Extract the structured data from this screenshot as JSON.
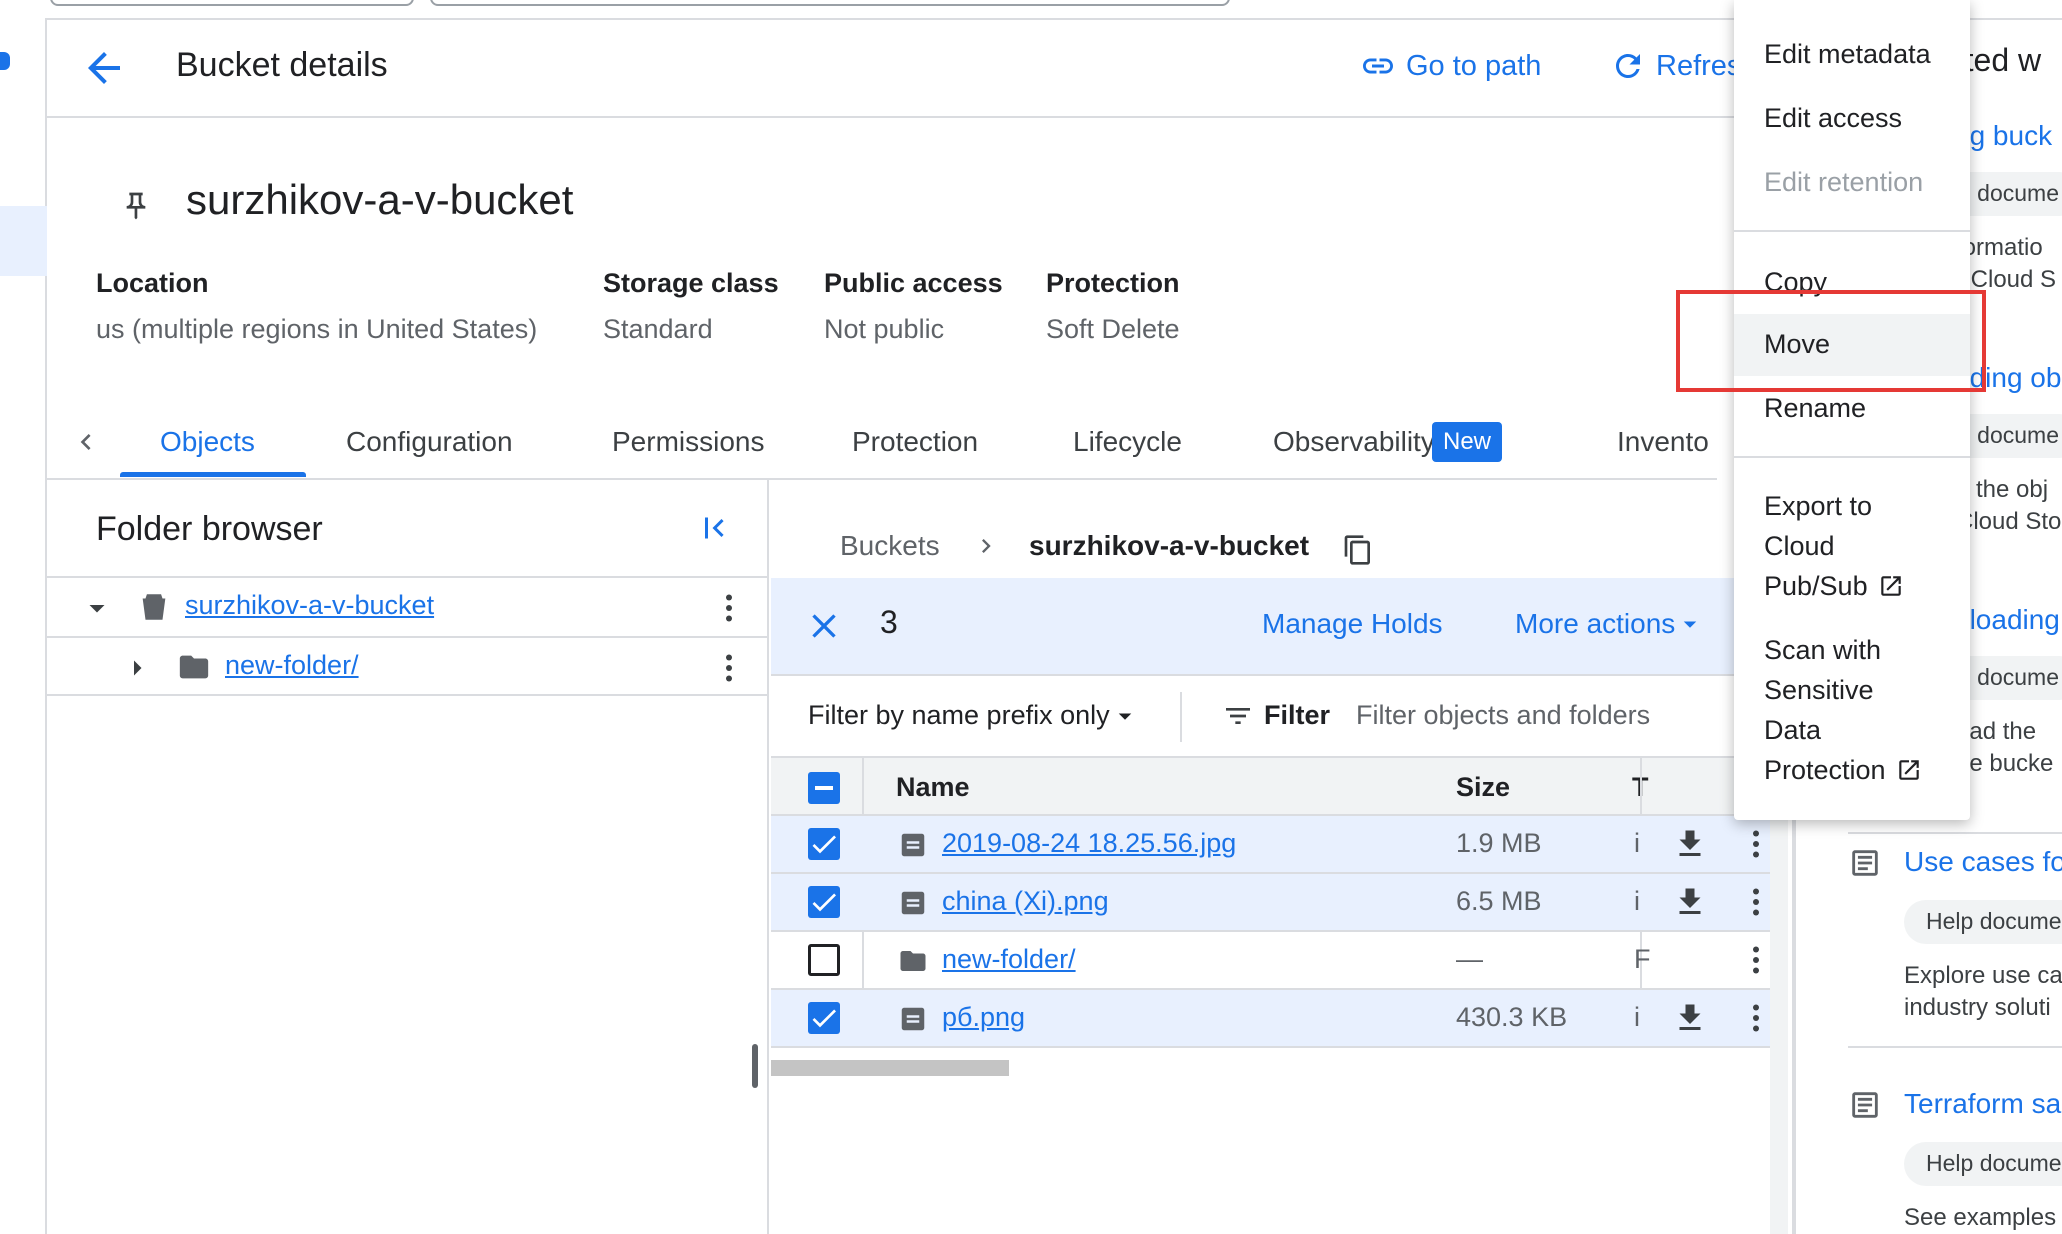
{
  "header": {
    "title": "Bucket details",
    "go_to_path": "Go to path",
    "refresh": "Refres"
  },
  "bucket": {
    "name": "surzhikov-a-v-bucket",
    "meta": [
      {
        "label": "Location",
        "value": "us (multiple regions in United States)"
      },
      {
        "label": "Storage class",
        "value": "Standard"
      },
      {
        "label": "Public access",
        "value": "Not public"
      },
      {
        "label": "Protection",
        "value": "Soft Delete"
      }
    ]
  },
  "tabs": [
    "Objects",
    "Configuration",
    "Permissions",
    "Protection",
    "Lifecycle",
    "Observability",
    "Invento"
  ],
  "new_badge": "New",
  "folder_browser": {
    "title": "Folder browser",
    "items": [
      {
        "label": "surzhikov-a-v-bucket"
      },
      {
        "label": "new-folder/"
      }
    ]
  },
  "objects": {
    "breadcrumb": {
      "root": "Buckets",
      "current": "surzhikov-a-v-bucket"
    },
    "selection": {
      "count": "3",
      "manage_holds": "Manage Holds",
      "more_actions": "More actions"
    },
    "filter": {
      "prefix": "Filter by name prefix only",
      "filter_label": "Filter",
      "placeholder": "Filter objects and folders"
    },
    "columns": {
      "name": "Name",
      "size": "Size",
      "type": "T"
    },
    "rows": [
      {
        "name": "2019-08-24 18.25.56.jpg",
        "size": "1.9 MB",
        "type": "i"
      },
      {
        "name": "china (Xi).png",
        "size": "6.5 MB",
        "type": "i"
      },
      {
        "name": "new-folder/",
        "size": "—",
        "type": "F"
      },
      {
        "name": "рб.png",
        "size": "430.3 KB",
        "type": "i"
      }
    ]
  },
  "menu": {
    "edit_metadata": "Edit metadata",
    "edit_access": "Edit access",
    "edit_retention": "Edit retention",
    "copy": "Copy",
    "move": "Move",
    "rename": "Rename",
    "export_l1": "Export to",
    "export_l2": "Cloud",
    "export_l3": "Pub/Sub",
    "scan_l1": "Scan with",
    "scan_l2": "Sensitive",
    "scan_l3": "Data",
    "scan_l4": "Protection"
  },
  "right_panel": {
    "heading": "rted w",
    "link1": "ng buck",
    "chip1": "o docume",
    "text1a": "formatio",
    "text1b": "r Cloud S",
    "link2": "ading ob",
    "chip2": "o docume",
    "text2a": "d the obj",
    "text2b": "Cloud Sto",
    "link3": "nloading",
    "chip3": "o docume",
    "text3a": "oad the",
    "text3b": "ge bucke",
    "link4": "Use cases fo",
    "chip4": "Help docume",
    "text4a": "Explore use ca",
    "text4b": "industry soluti",
    "link5": "Terraform sa",
    "chip5": "Help docume",
    "text5a": "See examples"
  }
}
